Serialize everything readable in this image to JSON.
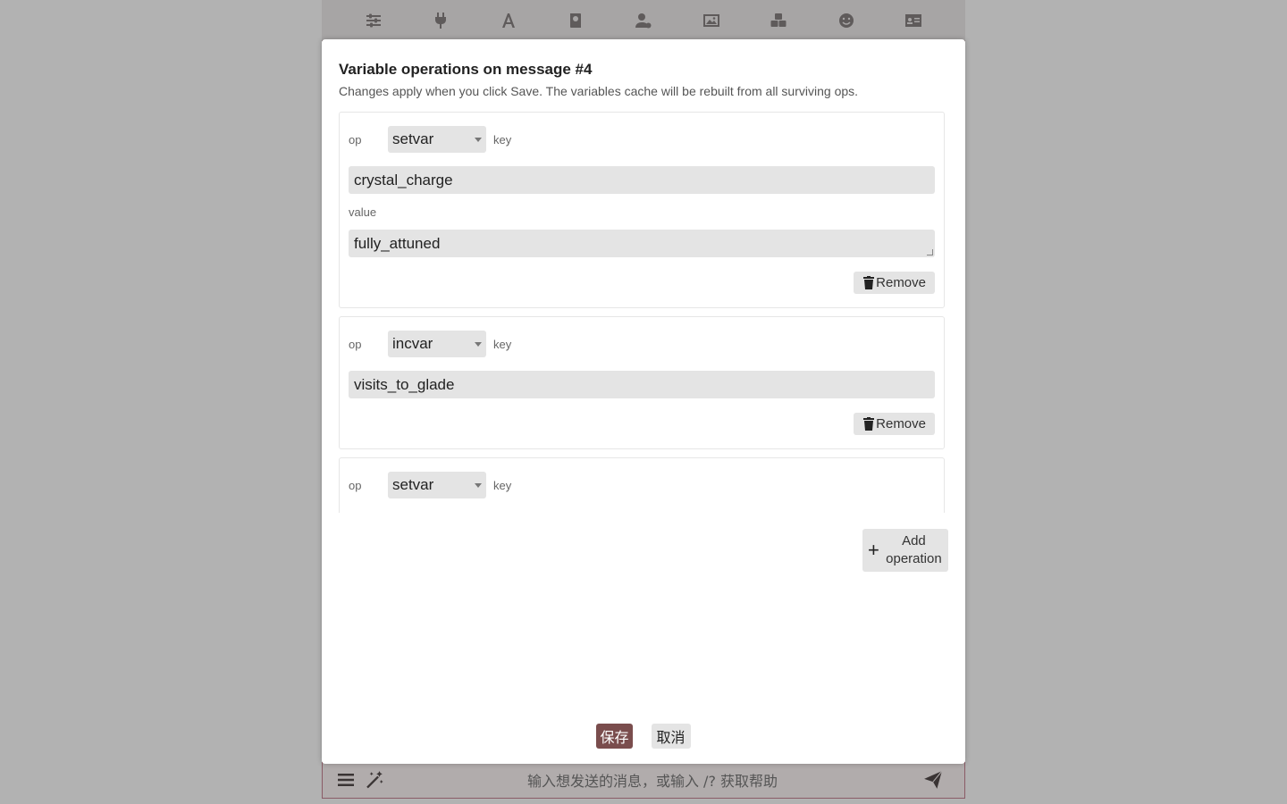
{
  "topbar": {
    "icons": [
      "sliders-icon",
      "plug-icon",
      "font-icon",
      "book-icon",
      "user-gear-icon",
      "image-icon",
      "cubes-icon",
      "smile-icon",
      "id-card-icon"
    ]
  },
  "dialog": {
    "title": "Variable operations on message #4",
    "subtitle": "Changes apply when you click Save. The variables cache will be rebuilt from all surviving ops.",
    "op_label": "op",
    "key_label": "key",
    "value_label": "value",
    "remove_label": "Remove",
    "operations": [
      {
        "op": "setvar",
        "key": "crystal_charge",
        "value": "fully_attuned"
      },
      {
        "op": "incvar",
        "key": "visits_to_glade"
      },
      {
        "op": "setvar"
      }
    ],
    "add_label": "Add operation",
    "save_label": "保存",
    "cancel_label": "取消"
  },
  "send_form": {
    "placeholder": "输入想发送的消息，或输入 /? 获取帮助"
  },
  "colors": {
    "accent": "#7a4d4d",
    "overlay": "#b2b2b2",
    "field_bg": "#e4e4e4"
  }
}
